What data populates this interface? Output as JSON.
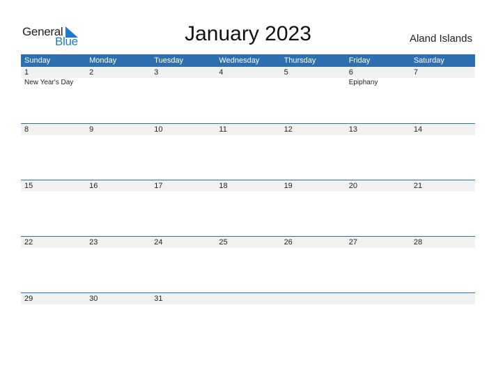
{
  "logo": {
    "line1": "General",
    "line2": "Blue"
  },
  "title": "January 2023",
  "region": "Aland Islands",
  "colors": {
    "header_bg": "#2e6fb0",
    "accent": "#1f7bc7",
    "day_row_bg": "#f1f1f1"
  },
  "weekdays": [
    "Sunday",
    "Monday",
    "Tuesday",
    "Wednesday",
    "Thursday",
    "Friday",
    "Saturday"
  ],
  "weeks": [
    {
      "days": [
        "1",
        "2",
        "3",
        "4",
        "5",
        "6",
        "7"
      ],
      "events": [
        "New Year's Day",
        "",
        "",
        "",
        "",
        "Epiphany",
        ""
      ]
    },
    {
      "days": [
        "8",
        "9",
        "10",
        "11",
        "12",
        "13",
        "14"
      ],
      "events": [
        "",
        "",
        "",
        "",
        "",
        "",
        ""
      ]
    },
    {
      "days": [
        "15",
        "16",
        "17",
        "18",
        "19",
        "20",
        "21"
      ],
      "events": [
        "",
        "",
        "",
        "",
        "",
        "",
        ""
      ]
    },
    {
      "days": [
        "22",
        "23",
        "24",
        "25",
        "26",
        "27",
        "28"
      ],
      "events": [
        "",
        "",
        "",
        "",
        "",
        "",
        ""
      ]
    },
    {
      "days": [
        "29",
        "30",
        "31",
        "",
        "",
        "",
        ""
      ],
      "events": [
        "",
        "",
        "",
        "",
        "",
        "",
        ""
      ]
    }
  ]
}
